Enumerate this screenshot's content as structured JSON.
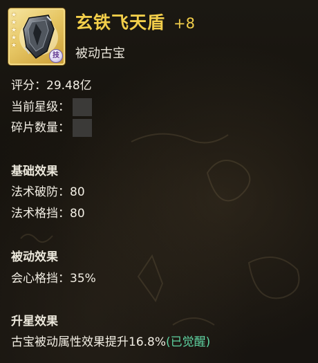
{
  "item": {
    "name": "玄铁飞天盾",
    "level": "+8",
    "type": "被动古宝",
    "stars": [
      "★",
      "★",
      "★",
      "★",
      "★"
    ],
    "badge": "技",
    "icon": "iron-shield-icon"
  },
  "stats": {
    "score_label": "评分：",
    "score_value": "29.48亿",
    "star_level_label": "当前星级：",
    "fragments_label": "碎片数量："
  },
  "basic_effects": {
    "heading": "基础效果",
    "lines": [
      {
        "label": "法术破防：",
        "value": "80"
      },
      {
        "label": "法术格挡：",
        "value": "80"
      }
    ]
  },
  "passive_effects": {
    "heading": "被动效果",
    "lines": [
      {
        "label": "会心格挡：",
        "value": "35%"
      }
    ]
  },
  "star_up_effects": {
    "heading": "升星效果",
    "text": "古宝被动属性效果提升16.8%",
    "status": "(已觉醒)"
  },
  "colors": {
    "title_gold": "#f2ce4a",
    "awakened_green": "#5fd4a2",
    "panel_bg": "#17140f"
  }
}
